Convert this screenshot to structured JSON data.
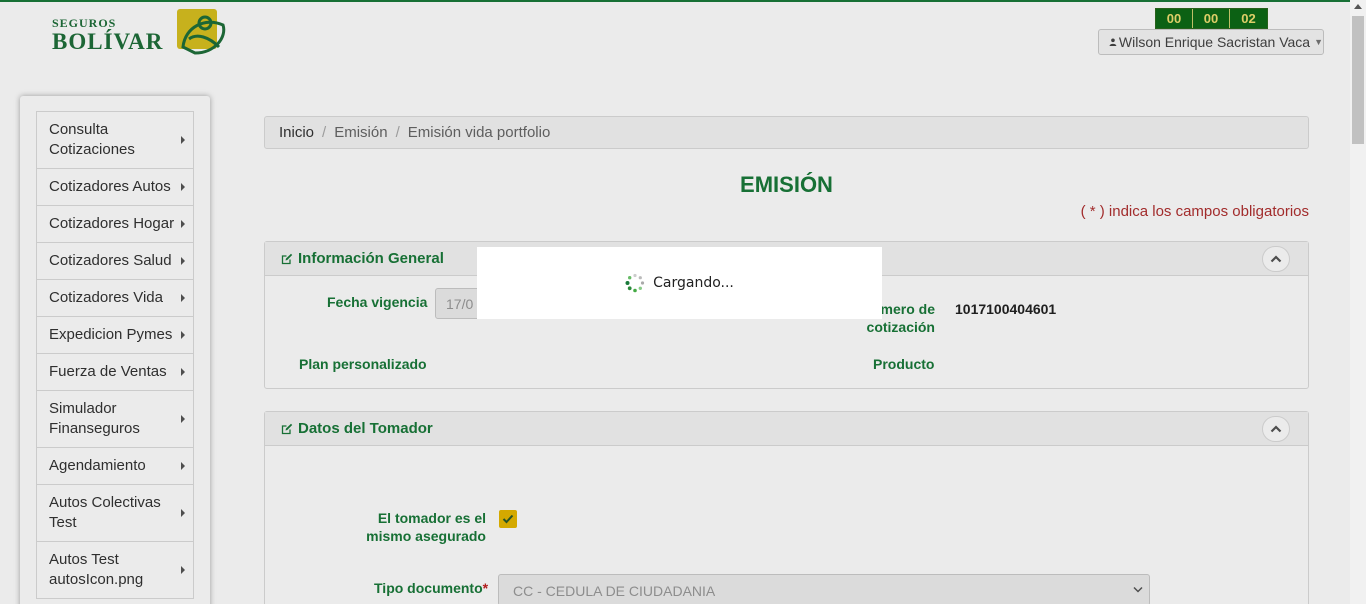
{
  "header": {
    "logo_small": "SEGUROS",
    "logo_big": "BOLÍVAR",
    "timer": [
      "00",
      "00",
      "02"
    ],
    "user_name": "Wilson Enrique Sacristan Vaca"
  },
  "sidebar": {
    "items": [
      {
        "label": "Consulta Cotizaciones"
      },
      {
        "label": "Cotizadores Autos"
      },
      {
        "label": "Cotizadores Hogar"
      },
      {
        "label": "Cotizadores Salud"
      },
      {
        "label": "Cotizadores Vida"
      },
      {
        "label": "Expedicion Pymes"
      },
      {
        "label": "Fuerza de Ventas"
      },
      {
        "label": "Simulador Finanseguros"
      },
      {
        "label": "Agendamiento"
      },
      {
        "label": "Autos Colectivas Test"
      },
      {
        "label": "Autos Test autosIcon.png"
      }
    ]
  },
  "breadcrumb": {
    "items": [
      "Inicio",
      "Emisión",
      "Emisión vida portfolio"
    ]
  },
  "page": {
    "title": "EMISIÓN",
    "required_note": "( * ) indica los campos obligatorios"
  },
  "panel_general": {
    "title": "Información General",
    "fecha_vigencia_label": "Fecha vigencia",
    "fecha_vigencia_value": "17/0",
    "numero_cotizacion_label": "mero de cotización",
    "numero_cotizacion_value": "1017100404601",
    "plan_label": "Plan personalizado",
    "producto_label": "Producto"
  },
  "panel_tomador": {
    "title": "Datos del Tomador",
    "mismo_asegurado_label": "El tomador es el mismo asegurado",
    "tipo_documento_label": "Tipo documento",
    "required_mark": "*",
    "tipo_documento_value": "CC - CEDULA DE CIUDADANIA"
  },
  "loading": {
    "text": "Cargando..."
  },
  "colors": {
    "brand_green": "#1a7a3a",
    "required_red": "#b03030",
    "checkbox_yellow": "#e6b800"
  }
}
